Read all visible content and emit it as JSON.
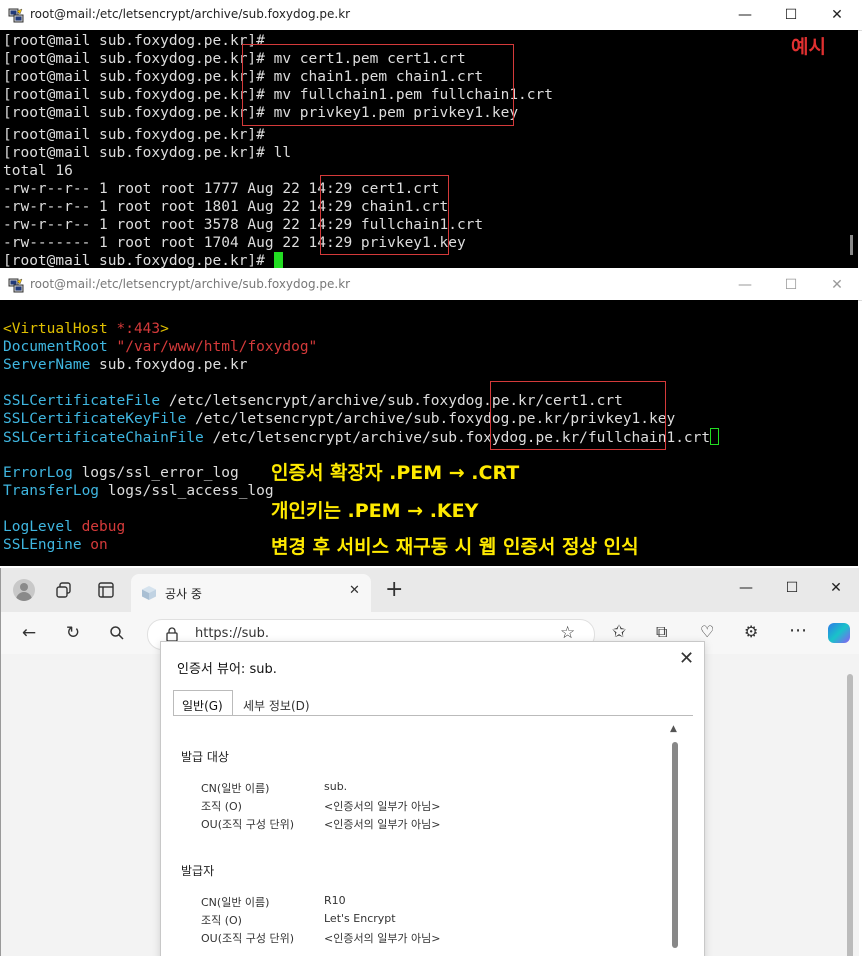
{
  "terminal1": {
    "title": "root@mail:/etc/letsencrypt/archive/sub.foxydog.pe.kr",
    "lines": [
      "[root@mail sub.foxydog.pe.kr]#",
      "[root@mail sub.foxydog.pe.kr]# mv cert1.pem cert1.crt",
      "[root@mail sub.foxydog.pe.kr]# mv chain1.pem chain1.crt",
      "[root@mail sub.foxydog.pe.kr]# mv fullchain1.pem fullchain1.crt",
      "[root@mail sub.foxydog.pe.kr]# mv privkey1.pem privkey1.key",
      "[root@mail sub.foxydog.pe.kr]#",
      "[root@mail sub.foxydog.pe.kr]# ll",
      "total 16",
      "-rw-r--r-- 1 root root 1777 Aug 22 14:29 cert1.crt",
      "-rw-r--r-- 1 root root 1801 Aug 22 14:29 chain1.crt",
      "-rw-r--r-- 1 root root 3578 Aug 22 14:29 fullchain1.crt",
      "-rw------- 1 root root 1704 Aug 22 14:29 privkey1.key",
      "[root@mail sub.foxydog.pe.kr]# "
    ],
    "example_label": "예시"
  },
  "terminal2": {
    "title": "root@mail:/etc/letsencrypt/archive/sub.foxydog.pe.kr",
    "vhost_open": "<VirtualHost",
    "vhost_port": " *:443",
    "vhost_close": ">",
    "docroot_key": "DocumentRoot",
    "docroot_val": " \"/var/www/html/foxydog\"",
    "servername_key": "ServerName",
    "servername_val": " sub.foxydog.pe.kr",
    "sslcert_key": "SSLCertificateFile",
    "sslcert_val": " /etc/letsencrypt/archive/sub.foxydog.pe.kr/cert1.crt",
    "sslkey_key": "SSLCertificateKeyFile",
    "sslkey_val": " /etc/letsencrypt/archive/sub.foxydog.pe.kr/privkey1.key",
    "sslchain_key": "SSLCertificateChainFile",
    "sslchain_val": " /etc/letsencrypt/archive/sub.foxydog.pe.kr/fullchain1.crt",
    "errorlog_key": "ErrorLog",
    "errorlog_val": " logs/ssl_error_log",
    "transferlog_key": "TransferLog",
    "transferlog_val": " logs/ssl_access_log",
    "loglevel_key": "LogLevel",
    "loglevel_val": " debug",
    "sslengine_key": "SSLEngine",
    "sslengine_val": " on",
    "annotations": [
      "인증서 확장자 .PEM → .CRT",
      "개인키는 .PEM → .KEY",
      "변경 후 서비스 재구동 시 웹 인증서 정상 인식"
    ]
  },
  "browser": {
    "tab_title": "공사 중",
    "url": "https://sub.",
    "dialog": {
      "title": "인증서 뷰어: sub.",
      "tabs": [
        "일반(G)",
        "세부 정보(D)"
      ],
      "issued_to_heading": "발급 대상",
      "issued_by_heading": "발급자",
      "issued_to": [
        {
          "label": "CN(일반 이름)",
          "value": "sub."
        },
        {
          "label": "조직 (O)",
          "value": "<인증서의 일부가 아님>"
        },
        {
          "label": "OU(조직 구성 단위)",
          "value": "<인증서의 일부가 아님>"
        }
      ],
      "issued_by": [
        {
          "label": "CN(일반 이름)",
          "value": "R10"
        },
        {
          "label": "조직 (O)",
          "value": "Let's Encrypt"
        },
        {
          "label": "OU(조직 구성 단위)",
          "value": "<인증서의 일부가 아님>"
        }
      ]
    }
  },
  "colors": {
    "terminal_bg": "#000000",
    "highlight_box": "#d43a3a",
    "annotation": "#ffea00",
    "cursor": "#22dd22"
  }
}
